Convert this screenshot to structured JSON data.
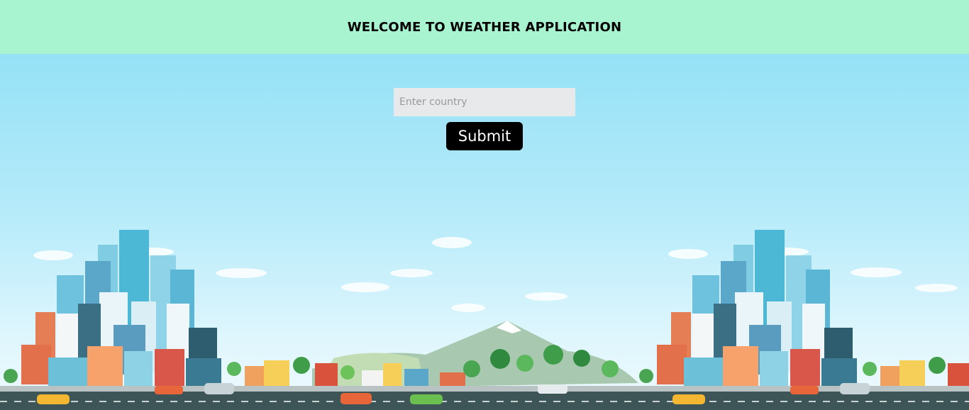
{
  "header": {
    "title": "WELCOME TO WEATHER APPLICATION"
  },
  "search": {
    "placeholder": "Enter country",
    "value": ""
  },
  "form": {
    "submit_label": "Submit"
  },
  "colors": {
    "header_bg": "#a8f4d0",
    "sky_top": "#95e1f6",
    "button_bg": "#000000",
    "input_bg": "#e7e9eb"
  }
}
